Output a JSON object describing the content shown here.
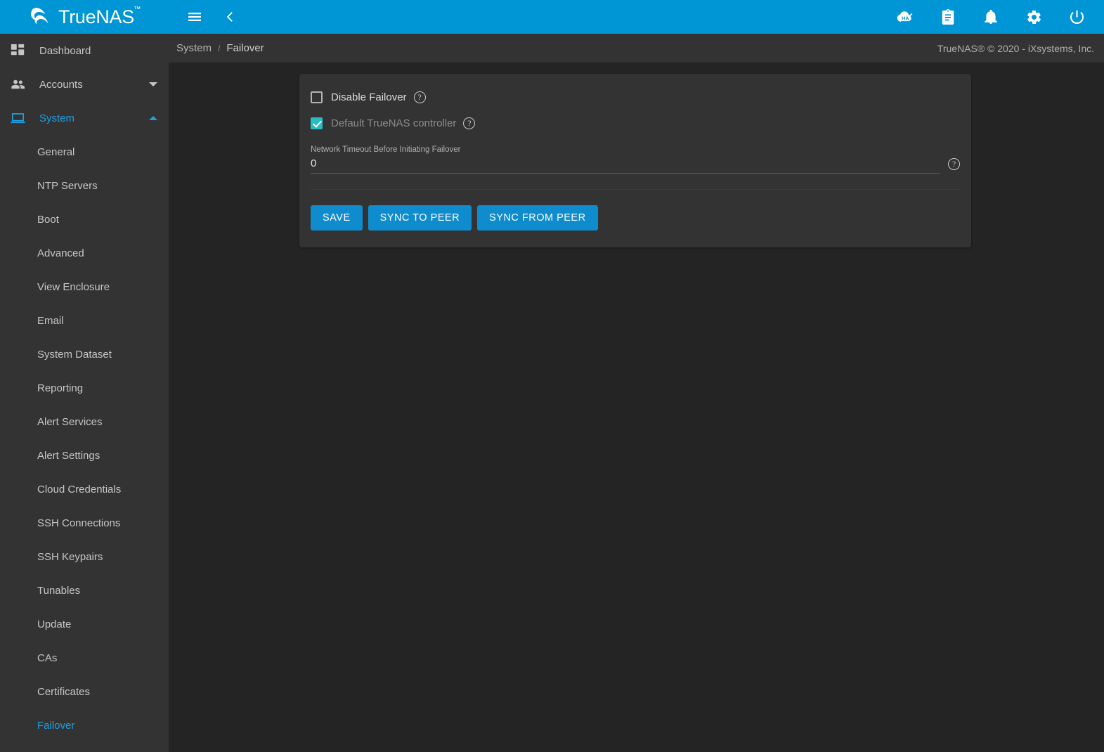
{
  "brand": {
    "name": "TrueNAS",
    "logo_icon": "truenas-wave-logo"
  },
  "topbar": {
    "menu_icon": "hamburger-menu-icon",
    "back_icon": "chevron-left-icon",
    "actions": [
      {
        "icon": "ha-status-icon",
        "label": "HA"
      },
      {
        "icon": "clipboard-tasks-icon",
        "label": "Tasks"
      },
      {
        "icon": "bell-alerts-icon",
        "label": "Alerts"
      },
      {
        "icon": "gear-settings-icon",
        "label": "Settings"
      },
      {
        "icon": "power-icon",
        "label": "Power"
      }
    ]
  },
  "breadcrumb": {
    "parent": "System",
    "separator": "/",
    "current": "Failover"
  },
  "footer": {
    "copyright": "TrueNAS® © 2020 - iXsystems, Inc."
  },
  "sidebar": {
    "items": [
      {
        "label": "Dashboard",
        "icon": "dashboard-grid-icon",
        "active": false,
        "expandable": false
      },
      {
        "label": "Accounts",
        "icon": "people-icon",
        "active": false,
        "expandable": true,
        "expanded": false
      },
      {
        "label": "System",
        "icon": "laptop-icon",
        "active": true,
        "expandable": true,
        "expanded": true
      }
    ],
    "system_children": [
      {
        "label": "General",
        "active": false
      },
      {
        "label": "NTP Servers",
        "active": false
      },
      {
        "label": "Boot",
        "active": false
      },
      {
        "label": "Advanced",
        "active": false
      },
      {
        "label": "View Enclosure",
        "active": false
      },
      {
        "label": "Email",
        "active": false
      },
      {
        "label": "System Dataset",
        "active": false
      },
      {
        "label": "Reporting",
        "active": false
      },
      {
        "label": "Alert Services",
        "active": false
      },
      {
        "label": "Alert Settings",
        "active": false
      },
      {
        "label": "Cloud Credentials",
        "active": false
      },
      {
        "label": "SSH Connections",
        "active": false
      },
      {
        "label": "SSH Keypairs",
        "active": false
      },
      {
        "label": "Tunables",
        "active": false
      },
      {
        "label": "Update",
        "active": false
      },
      {
        "label": "CAs",
        "active": false
      },
      {
        "label": "Certificates",
        "active": false
      },
      {
        "label": "Failover",
        "active": true
      }
    ]
  },
  "form": {
    "disable_failover": {
      "label": "Disable Failover",
      "checked": false,
      "help_icon": "help-circle-icon"
    },
    "default_controller": {
      "label": "Default TrueNAS controller",
      "checked": true,
      "disabled": true,
      "help_icon": "help-circle-icon"
    },
    "network_timeout": {
      "label": "Network Timeout Before Initiating Failover",
      "value": "0",
      "placeholder": "",
      "help_icon": "help-circle-icon"
    },
    "buttons": [
      {
        "label": "SAVE",
        "name": "save-button"
      },
      {
        "label": "SYNC TO PEER",
        "name": "sync-to-peer-button"
      },
      {
        "label": "SYNC FROM PEER",
        "name": "sync-from-peer-button"
      }
    ]
  },
  "colors": {
    "header_blue": "#0095d5",
    "accent_blue": "#1e9fe0",
    "button_blue": "#0e8ccd",
    "checkbox_teal": "#26bdc3",
    "sidebar_bg": "#333333",
    "page_bg": "#242424",
    "card_bg": "#333333"
  }
}
